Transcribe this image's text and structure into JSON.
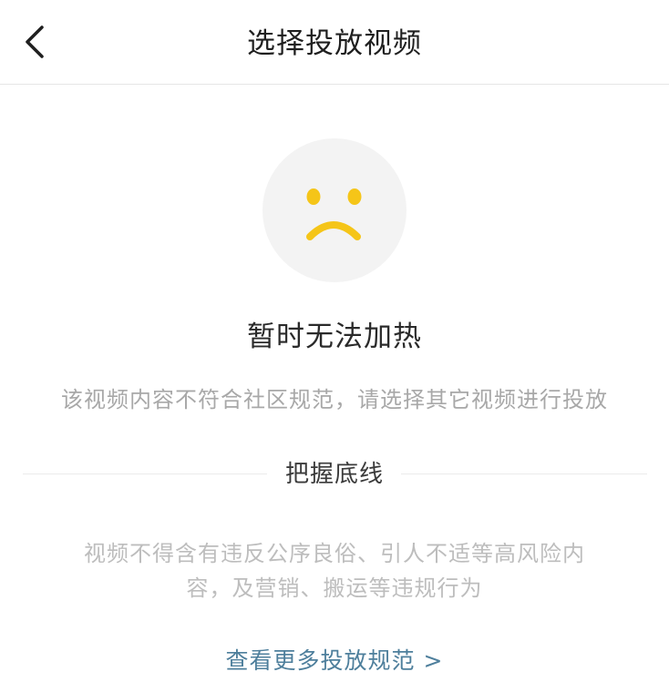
{
  "header": {
    "title": "选择投放视频",
    "back_icon": "chevron-left-icon"
  },
  "status": {
    "icon": "sad-face-icon",
    "icon_color": "#f5c518",
    "icon_bg": "#f3f3f3",
    "title": "暂时无法加热",
    "description": "该视频内容不符合社区规范，请选择其它视频进行投放"
  },
  "guideline": {
    "section_title": "把握底线",
    "rule_line1": "视频不得含有违反公序良俗、引人不适等高风险内",
    "rule_line2": "容，及营销、搬运等违规行为"
  },
  "footer": {
    "link_label": "查看更多投放规范 >",
    "link_color": "#4e7f9c"
  }
}
